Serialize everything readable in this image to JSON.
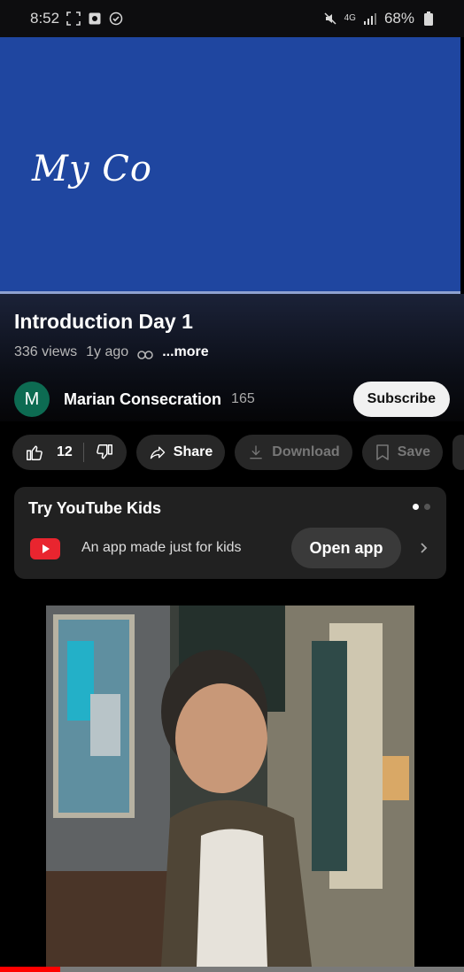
{
  "status_bar": {
    "time": "8:52",
    "battery": "68%",
    "network": "4G"
  },
  "video": {
    "overlay_text": "My Co",
    "background_color": "#1f46a0"
  },
  "info": {
    "title": "Introduction Day 1",
    "views": "336 views",
    "age": "1y ago",
    "more_label": "...more"
  },
  "channel": {
    "avatar_letter": "M",
    "avatar_color": "#0d6b52",
    "name": "Marian Consecration",
    "subscriber_count": "165",
    "subscribe_label": "Subscribe"
  },
  "actions": {
    "like_count": "12",
    "share_label": "Share",
    "download_label": "Download",
    "save_label": "Save"
  },
  "kids_promo": {
    "title": "Try YouTube Kids",
    "description": "An app made just for kids",
    "open_app_label": "Open app",
    "page_count": 2,
    "active_page": 0
  },
  "playback": {
    "progress_percent": 13,
    "accent_color": "#ff0000"
  }
}
